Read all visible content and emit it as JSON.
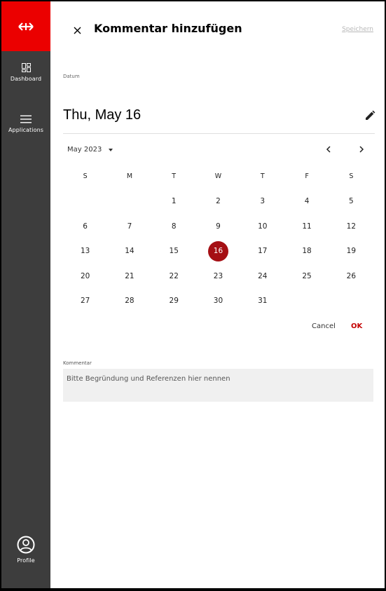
{
  "sidebar": {
    "logo_icon": "sbb-arrows-logo-icon",
    "items": [
      {
        "label": "Dashboard",
        "icon": "dashboard-icon"
      },
      {
        "label": "Applications",
        "icon": "menu-icon"
      }
    ],
    "profile": {
      "label": "Profile",
      "icon": "user-circle-icon"
    }
  },
  "dialog": {
    "title": "Kommentar hinzufügen",
    "save_label": "Speichern",
    "close_icon": "close-icon"
  },
  "datepicker": {
    "label": "Datum",
    "selected_display": "Thu, May 16",
    "month_label": "May 2023",
    "weekdays": [
      "S",
      "M",
      "T",
      "W",
      "T",
      "F",
      "S"
    ],
    "weeks": [
      [
        "",
        "",
        "1",
        "2",
        "3",
        "4",
        "5"
      ],
      [
        "6",
        "7",
        "8",
        "9",
        "10",
        "11",
        "12"
      ],
      [
        "13",
        "14",
        "15",
        "16",
        "17",
        "18",
        "19"
      ],
      [
        "20",
        "21",
        "22",
        "23",
        "24",
        "25",
        "26"
      ],
      [
        "27",
        "28",
        "29",
        "30",
        "31",
        "",
        ""
      ]
    ],
    "selected_day": "16",
    "cancel_label": "Cancel",
    "ok_label": "OK"
  },
  "comment": {
    "label": "Kommentar",
    "placeholder": "Bitte Begründung und Referenzen hier nennen"
  },
  "colors": {
    "brand_red": "#eb0000",
    "selected_red": "#a50f14",
    "sidebar_bg": "#3d3d3d"
  }
}
